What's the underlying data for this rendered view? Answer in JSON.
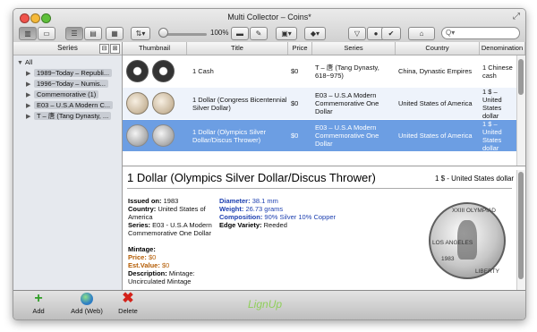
{
  "window": {
    "title": "Multi Collector – Coins*",
    "zoom": "100%",
    "search_placeholder": "Q▾"
  },
  "sidebar": {
    "header": "Series",
    "tree": [
      {
        "label": "All",
        "level": 0
      },
      {
        "label": "1989~Today – Republi...",
        "level": 1
      },
      {
        "label": "1996~Today – Numis...",
        "level": 1
      },
      {
        "label": "Commemorative (1)",
        "level": 1
      },
      {
        "label": "E03 – U.S.A Modern C...",
        "level": 1
      },
      {
        "label": "T – 唐 (Tang Dynasty, ...",
        "level": 1
      }
    ]
  },
  "table": {
    "columns": [
      "Thumbnail",
      "Title",
      "Price",
      "Series",
      "Country",
      "Denomination"
    ],
    "rows": [
      {
        "title": "1 Cash",
        "price": "$0",
        "series": "T – 唐 (Tang Dynasty, 618~975)",
        "country": "China, Dynastic Empires",
        "denomination": "1 Chinese cash",
        "thumb": "cash"
      },
      {
        "title": "1 Dollar (Congress Bicentennial Silver Dollar)",
        "price": "$0",
        "series": "E03 – U.S.A Modern Commemorative One Dollar",
        "country": "United States of America",
        "denomination": "1 $ – United States dollar",
        "thumb": "gold"
      },
      {
        "title": "1 Dollar (Olympics Silver Dollar/Discus Thrower)",
        "price": "$0",
        "series": "E03 – U.S.A Modern Commemorative One Dollar",
        "country": "United States of America",
        "denomination": "1 $ – United States dollar",
        "thumb": "silver"
      }
    ]
  },
  "detail": {
    "title": "1 Dollar (Olympics Silver Dollar/Discus Thrower)",
    "value": "1 $ - United States dollar",
    "issued_label": "Issued on:",
    "issued_value": "1983",
    "country_label": "Country:",
    "country_value": "United States of America",
    "series_label": "Series:",
    "series_value": "E03 - U.S.A Modern Commemorative One Dollar",
    "mintage_label": "Mintage:",
    "price_label": "Price:",
    "price_value": "$0",
    "est_label": "Est.Value:",
    "est_value": "$0",
    "desc_label": "Description:",
    "desc_value": "Mintage: Uncirculated Mintage",
    "diameter_label": "Diameter:",
    "diameter_value": "38.1 mm",
    "weight_label": "Weight:",
    "weight_value": "26.73 grams",
    "composition_label": "Composition:",
    "composition_value": "90% Silver 10% Copper",
    "edge_label": "Edge Variety:",
    "edge_value": "Reeded",
    "coin_texts": [
      "XXIII OLYMPIAD",
      "LOS ANGELES",
      "LIBERTY",
      "1983"
    ]
  },
  "bottom": {
    "add_label": "Add",
    "addweb_label": "Add (Web)",
    "delete_label": "Delete",
    "logo": "LignUp"
  }
}
